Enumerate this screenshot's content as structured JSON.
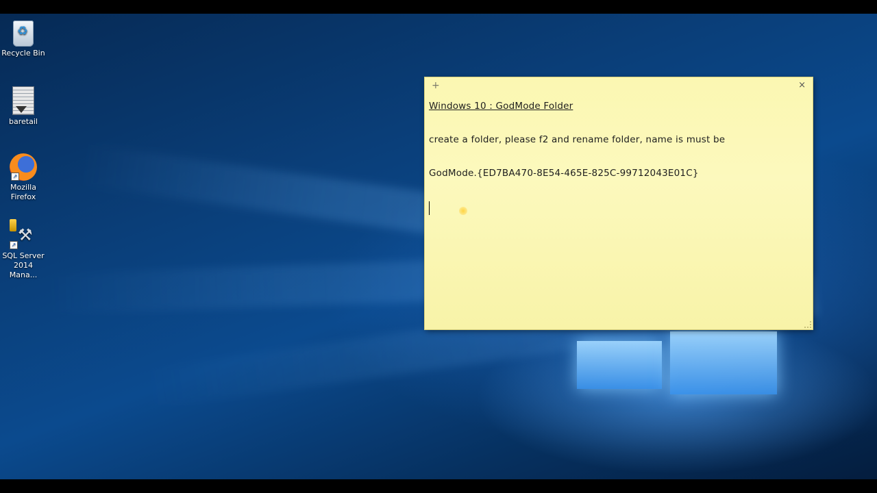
{
  "desktop": {
    "icons": [
      {
        "label": "Recycle Bin",
        "icon": "recycle-bin-icon"
      },
      {
        "label": "baretail",
        "icon": "baretail-icon"
      },
      {
        "label": "Mozilla Firefox",
        "icon": "firefox-icon"
      },
      {
        "label": "SQL Server 2014 Mana...",
        "icon": "sql-server-icon"
      }
    ]
  },
  "sticky_note": {
    "add_glyph": "+",
    "close_glyph": "×",
    "lines": [
      "Windows 10 : GodMode Folder",
      "create a folder, please f2 and rename folder, name is must be",
      "GodMode.{ED7BA470-8E54-465E-825C-99712043E01C}"
    ],
    "background_color": "#fcf9bd"
  },
  "colors": {
    "desktop_blue": "#0b4a8e",
    "note_yellow": "#fcf9bd"
  }
}
